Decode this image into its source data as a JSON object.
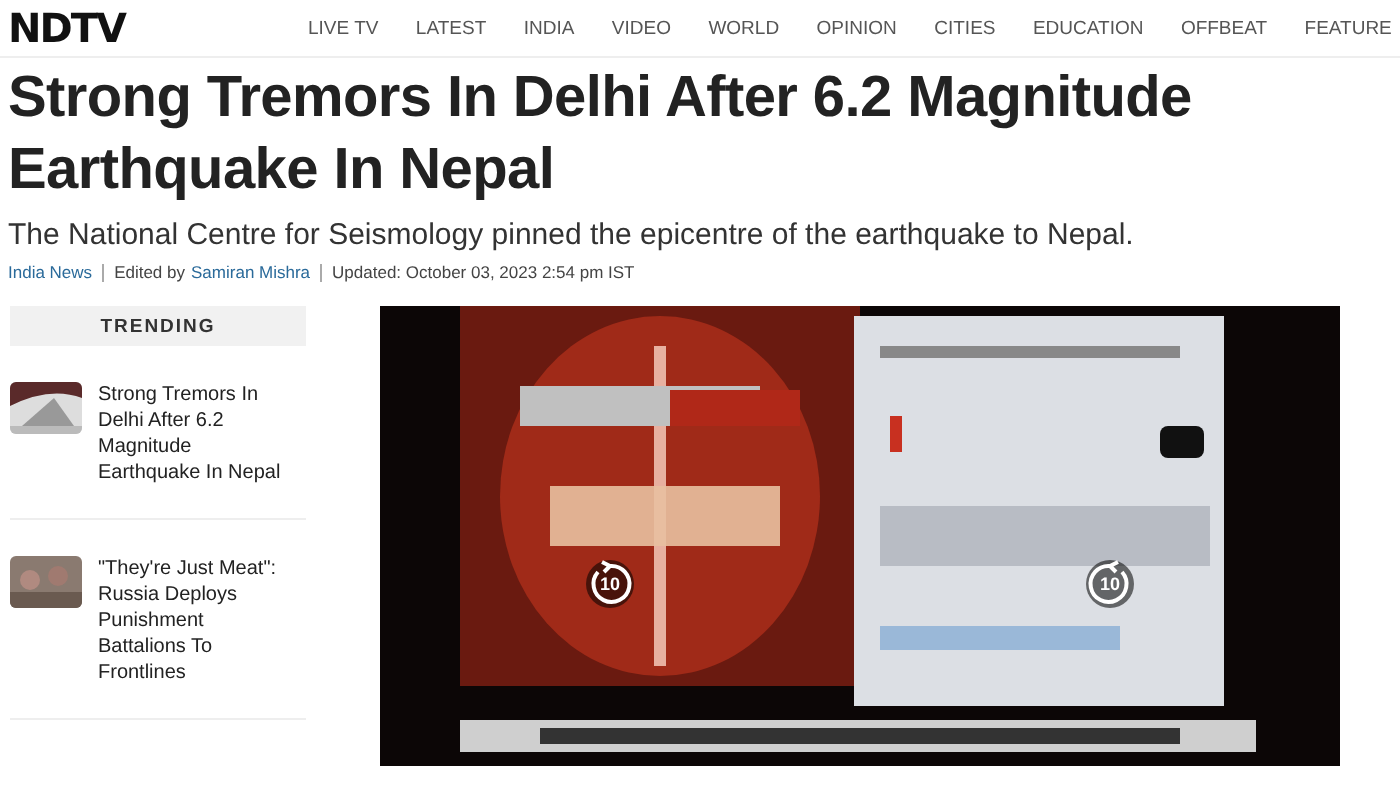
{
  "header": {
    "logo": "NDTV",
    "nav": [
      {
        "label": "LIVE TV"
      },
      {
        "label": "LATEST"
      },
      {
        "label": "INDIA"
      },
      {
        "label": "VIDEO"
      },
      {
        "label": "WORLD"
      },
      {
        "label": "OPINION"
      },
      {
        "label": "CITIES"
      },
      {
        "label": "EDUCATION"
      },
      {
        "label": "OFFBEAT"
      },
      {
        "label": "FEATURE"
      }
    ]
  },
  "article": {
    "headline": "Strong Tremors In Delhi After 6.2 Magnitude Earthquake In Nepal",
    "summary": "The National Centre for Seismology pinned the epicentre of the earthquake to Nepal.",
    "category": "India News",
    "edited_by_label": "Edited by",
    "editor": "Samiran Mishra",
    "updated": "Updated: October 03, 2023 2:54 pm IST"
  },
  "trending": {
    "title": "TRENDING",
    "items": [
      {
        "title": "Strong Tremors In Delhi After 6.2 Magnitude Earthquake In Nepal",
        "kind": "picture"
      },
      {
        "title": "\"They're Just Meat\": Russia Deploys Punishment Battalions To Frontlines",
        "kind": "picture"
      }
    ]
  },
  "video": {
    "kind": "picture",
    "rewind": "10",
    "forward": "10"
  }
}
